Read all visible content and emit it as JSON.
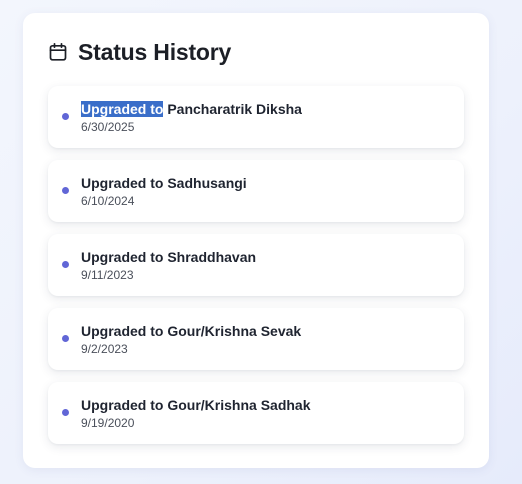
{
  "panel": {
    "title": "Status History",
    "title_icon": "calendar-icon"
  },
  "history": [
    {
      "prefix": "Upgraded to",
      "status": "Pancharatrik Diksha",
      "date": "6/30/2025",
      "selected_prefix": true
    },
    {
      "prefix": "Upgraded to",
      "status": "Sadhusangi",
      "date": "6/10/2024"
    },
    {
      "prefix": "Upgraded to",
      "status": "Shraddhavan",
      "date": "9/11/2023"
    },
    {
      "prefix": "Upgraded to",
      "status": "Gour/Krishna Sevak",
      "date": "9/2/2023"
    },
    {
      "prefix": "Upgraded to",
      "status": "Gour/Krishna Sadhak",
      "date": "9/19/2020"
    }
  ],
  "colors": {
    "dot": "#6166d6",
    "selection": "#3a6ec9"
  }
}
